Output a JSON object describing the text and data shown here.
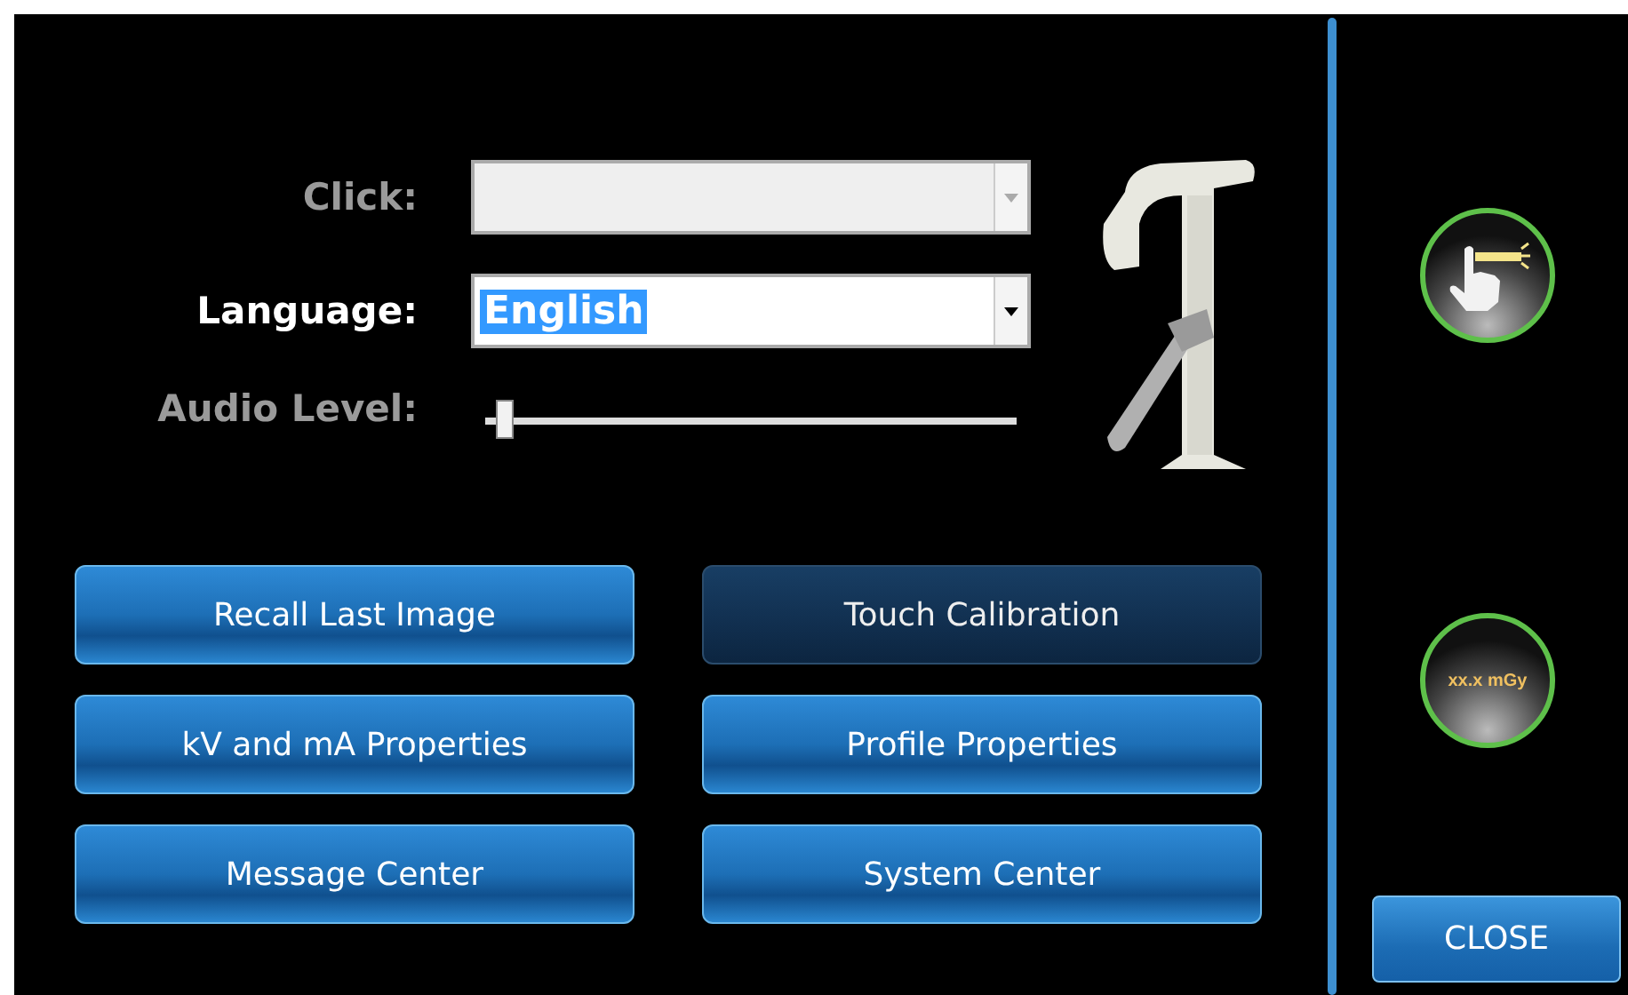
{
  "settings": [
    {
      "kind": "dropdown",
      "label": "Click:",
      "disabled": true
    },
    {
      "kind": "dropdown",
      "label": "Language:",
      "value": "English",
      "disabled": false,
      "value_selected": true
    },
    {
      "kind": "slider",
      "label": "Audio Level:",
      "disabled": true,
      "level": 0.02
    }
  ],
  "buttons": [
    {
      "label": "Recall Last Image",
      "disabled": false
    },
    {
      "label": "Touch Calibration",
      "disabled": true
    },
    {
      "label": "kV and mA Properties",
      "disabled": false
    },
    {
      "label": "Profile Properties",
      "disabled": false
    },
    {
      "label": "Message Center",
      "disabled": false
    },
    {
      "label": "System Center",
      "disabled": false
    }
  ],
  "side_buttons": [
    {
      "kind": "icon"
    },
    {
      "kind": "text",
      "label": "xx.x mGy"
    }
  ],
  "close_button": {
    "label": "CLOSE"
  }
}
